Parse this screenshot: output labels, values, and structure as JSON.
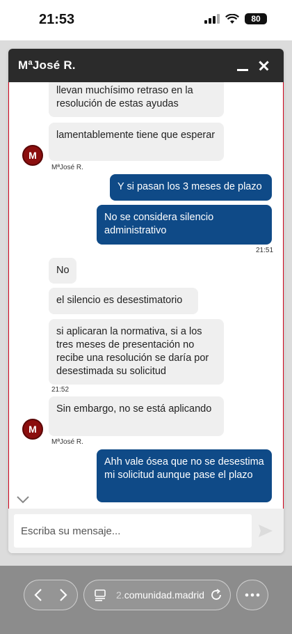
{
  "status_bar": {
    "time": "21:53",
    "battery": "80"
  },
  "chat": {
    "title": "MªJosé R.",
    "input_placeholder": "Escriba su mensaje...",
    "messages": [
      {
        "text": "llevan muchísimo retraso en la resolución de estas ayudas"
      },
      {
        "text": "lamentablemente tiene que esperar"
      },
      {
        "text": "Y si pasan los 3 meses de plazo"
      },
      {
        "text": "No se considera silencio administrativo"
      },
      {
        "text": "No"
      },
      {
        "text": "el silencio es desestimatorio"
      },
      {
        "text": "si aplicaran la normativa, si a los tres meses de presentación no recibe una resolución se daría por desestimada su solicitud"
      },
      {
        "text": "Sin  embargo, no se está aplicando"
      },
      {
        "text": "Ahh vale ósea que no se desestima mi solicitud aunque pase el plazo"
      }
    ],
    "meta": {
      "agent_name_1": "MªJosé R.",
      "time_1": "21:51",
      "time_2": "21:52",
      "agent_name_2": "MªJosé R."
    },
    "avatar_initial": "M"
  },
  "browser": {
    "url_prefix": "2.",
    "url_main": "comunidad.madrid"
  },
  "colors": {
    "header_bg": "#2b2b2b",
    "outgoing_bubble": "#0f4a87",
    "incoming_bubble": "#efefef",
    "avatar_bg": "#8b0e0e",
    "messages_border": "#d0021b"
  },
  "icons": [
    "minimize-icon",
    "close-icon",
    "chevron-down-icon",
    "send-icon",
    "back-icon",
    "forward-icon",
    "reader-icon",
    "reload-icon",
    "more-icon"
  ]
}
